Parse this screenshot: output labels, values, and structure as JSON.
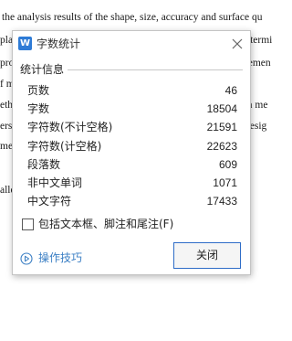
{
  "document": {
    "lines": [
      "the analysis results of the shape, size, accuracy and surface qu",
      "pla",
      "pro",
      "f m",
      "etho",
      "ers",
      " me",
      "alle",
      "etermi",
      "gemen",
      "on me",
      "desig"
    ]
  },
  "dialog": {
    "title": "字数统计",
    "app_icon_letter": "W",
    "group_title": "统计信息",
    "stats": [
      {
        "label": "页数",
        "value": "46"
      },
      {
        "label": "字数",
        "value": "18504"
      },
      {
        "label": "字符数(不计空格)",
        "value": "21591"
      },
      {
        "label": "字符数(计空格)",
        "value": "22623"
      },
      {
        "label": "段落数",
        "value": "609"
      },
      {
        "label": "非中文单词",
        "value": "1071"
      },
      {
        "label": "中文字符",
        "value": "17433"
      }
    ],
    "checkbox_label": "包括文本框、脚注和尾注(F)",
    "checkbox_checked": false,
    "tips_label": "操作技巧",
    "close_button_label": "关闭"
  },
  "colors": {
    "accent": "#2e6cc7",
    "link": "#3b7fc4",
    "icon": "#2e7bd6"
  }
}
